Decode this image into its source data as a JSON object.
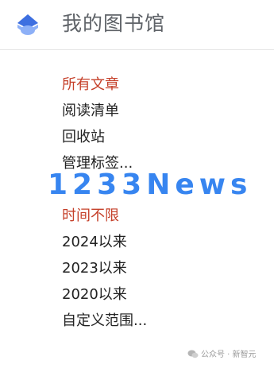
{
  "header": {
    "title": "我的图书馆",
    "logo_icon": "library-logo-icon",
    "logo_colors": {
      "top": "#3d6fe0",
      "bottom": "#8db0f7"
    }
  },
  "menu": {
    "sections": [
      {
        "heading": "所有文章",
        "items": [
          "阅读清单",
          "回收站",
          "管理标签..."
        ]
      },
      {
        "heading": "时间不限",
        "items": [
          "2024以来",
          "2023以来",
          "2020以来",
          "自定义范围..."
        ]
      }
    ]
  },
  "colors": {
    "heading": "#c5402a",
    "item_text": "#222222",
    "title_text": "#5f6368",
    "watermark": "#2d7ff0"
  },
  "overlay": {
    "watermark_text": "1233News",
    "footer_text": "公众号 · 新智元",
    "footer_icon": "wechat-icon"
  }
}
